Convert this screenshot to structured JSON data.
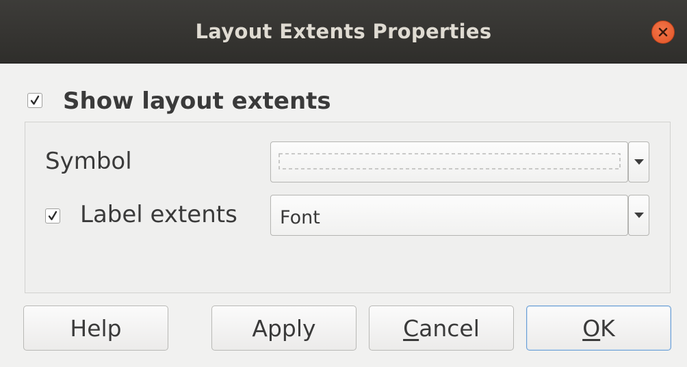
{
  "window": {
    "title": "Layout Extents Properties"
  },
  "show_extents": {
    "label": "Show layout extents",
    "checked": true
  },
  "symbol": {
    "label": "Symbol"
  },
  "label_extents": {
    "label": "Label extents",
    "checked": true,
    "font_value": "Font"
  },
  "buttons": {
    "help": "Help",
    "apply": "Apply",
    "cancel_first": "C",
    "cancel_rest": "ancel",
    "ok_first": "O",
    "ok_rest": "K"
  },
  "colors": {
    "titlebar": "#2f2e2b",
    "close": "#e95420",
    "ok_border": "#6a9ed4"
  }
}
